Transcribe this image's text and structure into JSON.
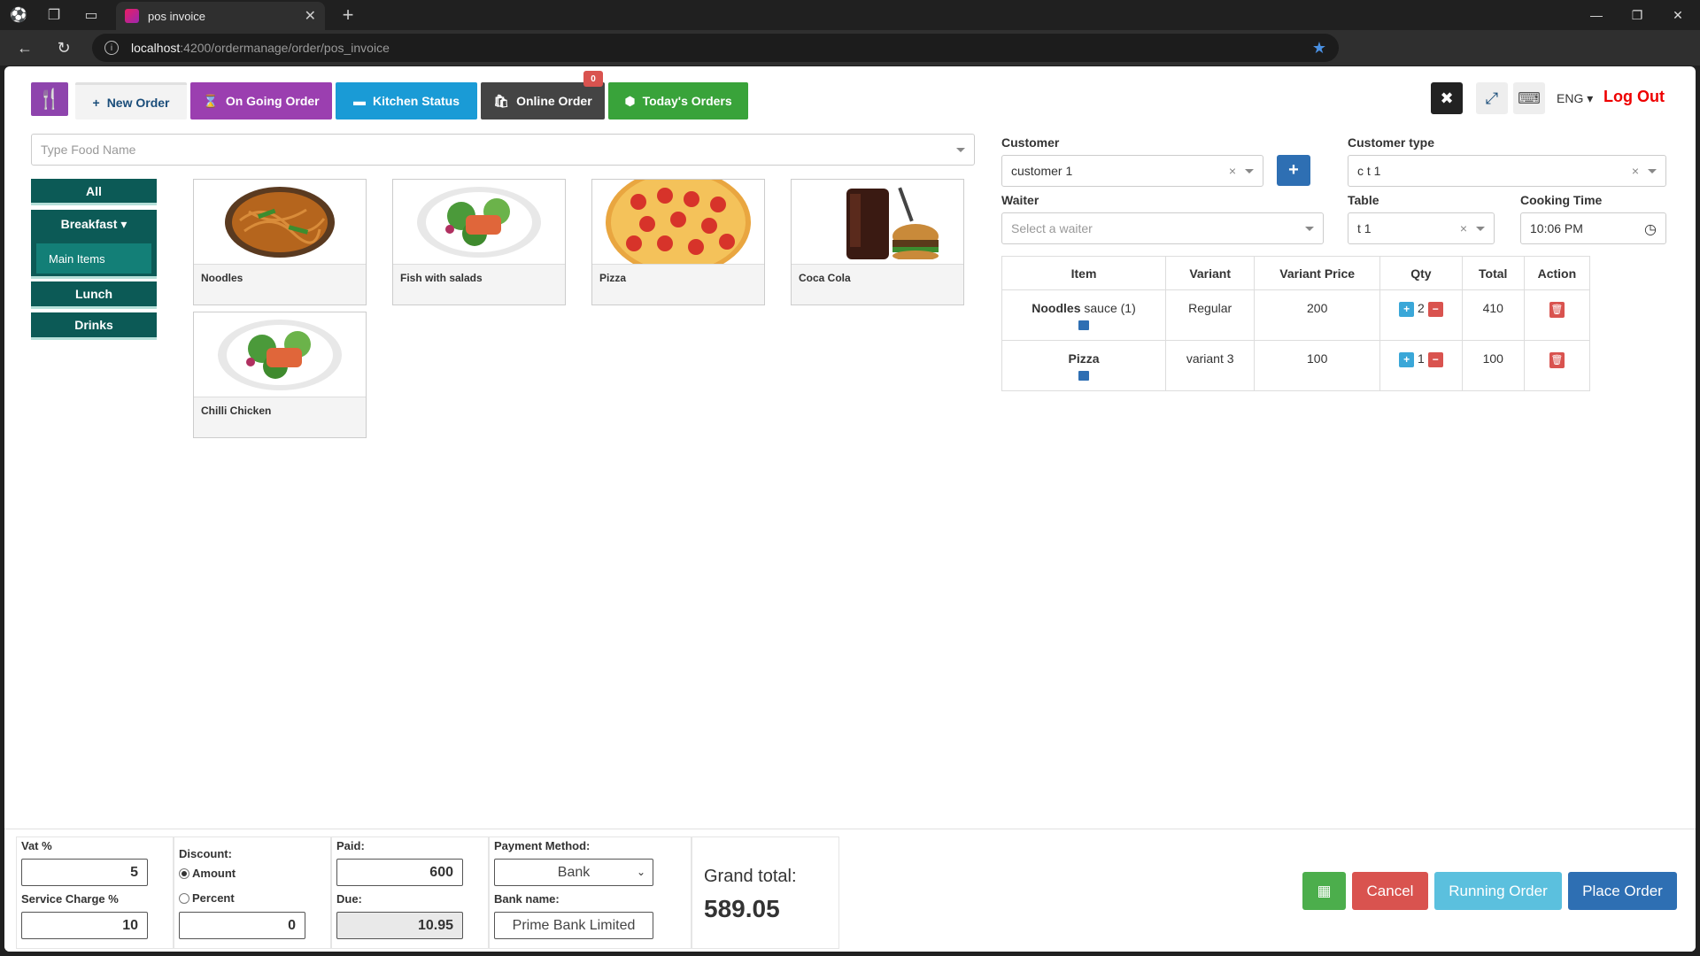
{
  "browser": {
    "tab_title": "pos invoice",
    "url_host": "localhost",
    "url_path": ":4200/ordermanage/order/pos_invoice"
  },
  "nav": {
    "new_order": "New Order",
    "ongoing_order": "On Going Order",
    "kitchen_status": "Kitchen Status",
    "online_order": "Online Order",
    "online_badge": "0",
    "todays_orders": "Today's Orders"
  },
  "top_right": {
    "language": "ENG",
    "logout": "Log Out"
  },
  "food_search": {
    "placeholder": "Type Food Name"
  },
  "categories": [
    {
      "label": "All"
    },
    {
      "label": "Breakfast",
      "subitems": [
        "Main Items"
      ]
    },
    {
      "label": "Lunch"
    },
    {
      "label": "Drinks"
    }
  ],
  "foods": [
    {
      "name": "Noodles",
      "icon": "noodles-image"
    },
    {
      "name": "Fish with salads",
      "icon": "salad-image"
    },
    {
      "name": "Pizza",
      "icon": "pizza-image"
    },
    {
      "name": "Coca Cola",
      "icon": "cola-burger-image"
    },
    {
      "name": "Chilli Chicken",
      "icon": "salad-image"
    }
  ],
  "form": {
    "customer_label": "Customer",
    "customer_value": "customer 1",
    "customer_type_label": "Customer type",
    "customer_type_value": "c t 1",
    "waiter_label": "Waiter",
    "waiter_placeholder": "Select a waiter",
    "table_label": "Table",
    "table_value": "t 1",
    "cooking_time_label": "Cooking Time",
    "cooking_time_value": "10:06  PM"
  },
  "order_table": {
    "headers": [
      "Item",
      "Variant",
      "Variant Price",
      "Qty",
      "Total",
      "Action"
    ],
    "rows": [
      {
        "item": "Noodles",
        "item_extra": " sauce (1)",
        "variant": "Regular",
        "variant_price": "200",
        "qty": "2",
        "total": "410"
      },
      {
        "item": "Pizza",
        "item_extra": "",
        "variant": "variant 3",
        "variant_price": "100",
        "qty": "1",
        "total": "100"
      }
    ]
  },
  "footer": {
    "vat_label": "Vat %",
    "vat_value": "5",
    "service_label": "Service Charge %",
    "service_value": "10",
    "discount_label": "Discount:",
    "discount_amount": "Amount",
    "discount_percent": "Percent",
    "discount_value": "0",
    "paid_label": "Paid:",
    "paid_value": "600",
    "due_label": "Due:",
    "due_value": "10.95",
    "payment_label": "Payment Method:",
    "payment_value": "Bank",
    "bank_label": "Bank name:",
    "bank_value": "Prime Bank Limited",
    "grand_total_label": "Grand total:",
    "grand_total_value": "589.05"
  },
  "actions": {
    "cancel": "Cancel",
    "running_order": "Running Order",
    "place_order": "Place Order"
  },
  "colors": {
    "accent_purple": "#8e44ad",
    "category_teal": "#0c5a56",
    "danger": "#d9534f",
    "primary": "#2e6fb3"
  }
}
